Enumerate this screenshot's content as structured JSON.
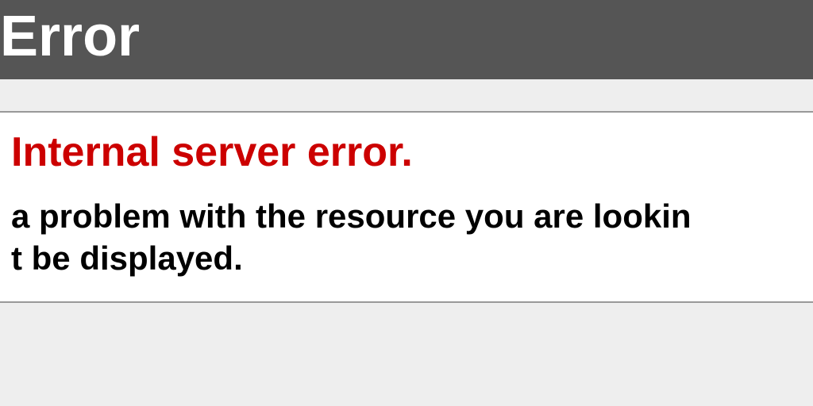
{
  "header": {
    "title": "Error"
  },
  "error": {
    "heading": "Internal server error.",
    "body_line1": "a problem with the resource you are lookin",
    "body_line2": "t be displayed."
  }
}
